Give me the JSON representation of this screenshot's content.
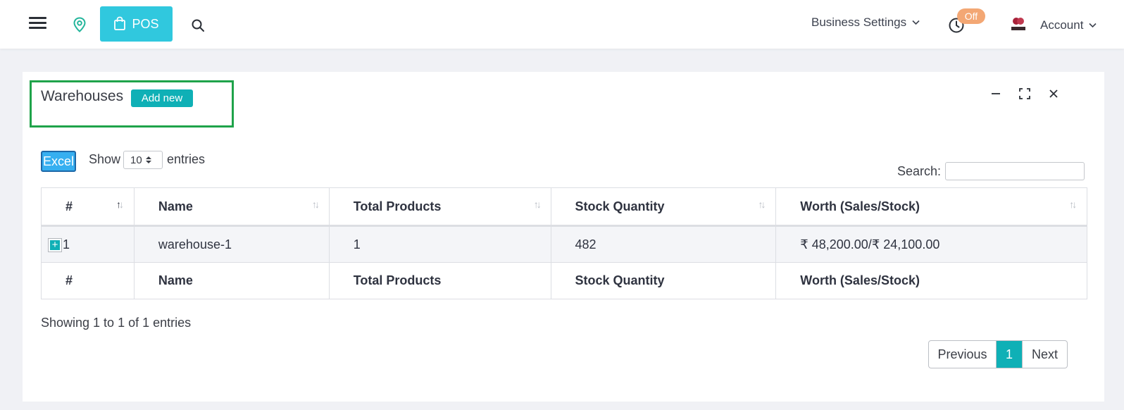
{
  "topbar": {
    "pos_label": "POS",
    "business_settings_label": "Business Settings",
    "off_badge": "Off",
    "account_label": "Account"
  },
  "card": {
    "title": "Warehouses",
    "add_new_label": "Add new"
  },
  "controls": {
    "excel_label": "Excel",
    "show_label": "Show",
    "entries_value": "10",
    "entries_label": "entries",
    "search_label": "Search:",
    "search_value": ""
  },
  "table": {
    "columns": [
      "#",
      "Name",
      "Total Products",
      "Stock Quantity",
      "Worth (Sales/Stock)"
    ],
    "rows": [
      {
        "index": "1",
        "name": "warehouse-1",
        "total_products": "1",
        "stock_quantity": "482",
        "worth": "₹ 48,200.00/₹ 24,100.00"
      }
    ]
  },
  "footer": {
    "showing_text": "Showing 1 to 1 of 1 entries",
    "prev_label": "Previous",
    "current_page": "1",
    "next_label": "Next"
  },
  "colors": {
    "accent": "#0fb0b6",
    "pos_button": "#30c8de",
    "off_badge": "#f3a774",
    "excel_button": "#36aff0",
    "highlight_box": "#1fa34a"
  }
}
